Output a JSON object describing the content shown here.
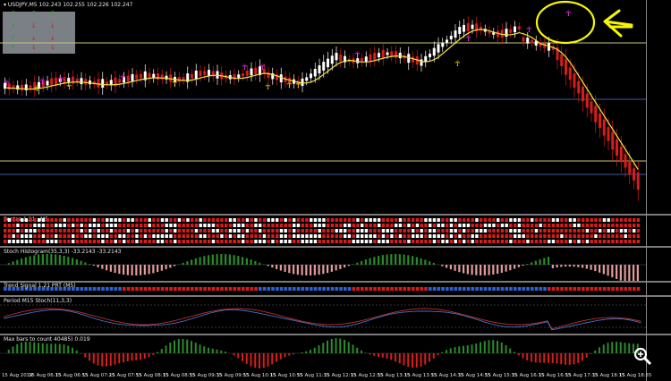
{
  "chart": {
    "title_line": "▾ USDJPY,M5   102.243  102.255  102.226  102.247",
    "colors": {
      "bull": "#ffffff",
      "bear": "#d81c1c",
      "ma": "#f0e040",
      "magenta": "#ff3cff",
      "yellow": "#f5e000",
      "green": "#2a8a2a",
      "pink": "#e39a9a",
      "blue": "#2a62d6",
      "level_blue": "#3a5fa8",
      "level_yellow": "#c8c47a",
      "annot": "#f6f600"
    }
  },
  "panes": {
    "stack": {
      "label": "Pentas 1.21 . M5..."
    },
    "stoch_hist": {
      "label": "Stoch Histogram(35,3,3) -33.2143 -33.2143"
    },
    "dots": {
      "label": "Trend Signal 1.21 PRT  (M5)"
    },
    "stoch": {
      "label": "Period M15 Stoch(11,3,3)"
    },
    "macd": {
      "label": "Max bars to count   40485)  0.019"
    }
  },
  "xaxis": {
    "labels": [
      "15 Aug 2014",
      "15 Aug 06:15",
      "15 Aug 06:55",
      "15 Aug 07:25",
      "15 Aug 07:55",
      "15 Aug 08:15",
      "15 Aug 08:55",
      "15 Aug 09:35",
      "15 Aug 09:55",
      "15 Aug 10:15",
      "15 Aug 10:55",
      "15 Aug 11:35",
      "15 Aug 12:15",
      "15 Aug 12:55",
      "15 Aug 13:15",
      "15 Aug 13:55",
      "15 Aug 14:35",
      "15 Aug 14:55",
      "15 Aug 15:35",
      "15 Aug 16:15",
      "15 Aug 16:55",
      "15 Aug 17:35",
      "15 Aug 18:15",
      "15 Aug 18:55"
    ]
  },
  "zoom_icon": "zoom-magnify-icon",
  "annotation": {
    "arrow_icon": "yellow-arrow-icon",
    "circle_icon": "yellow-circle-icon"
  }
}
